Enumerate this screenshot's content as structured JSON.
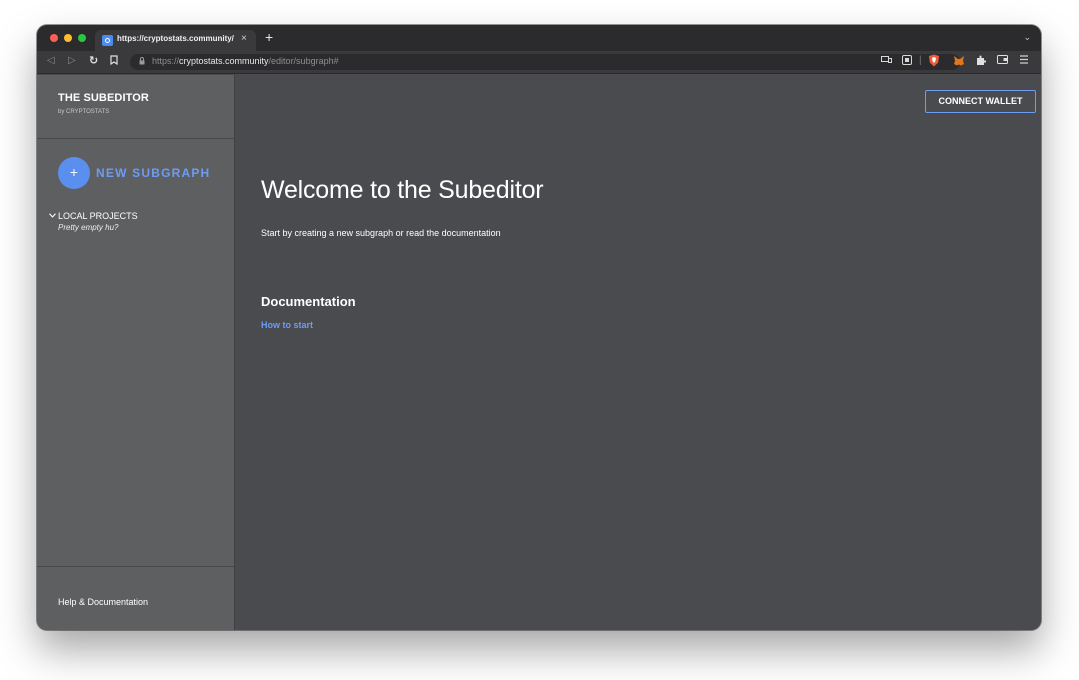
{
  "browser": {
    "tab_title": "https://cryptostats.community/",
    "tab_close": "×",
    "new_tab": "+",
    "tab_menu": "⌄",
    "url_scheme": "https://",
    "url_host": "cryptostats.community",
    "url_path": "/editor/subgraph#",
    "nav": {
      "back": "◁",
      "forward": "▷",
      "reload": "↻",
      "bookmark": "⊓"
    },
    "lock": "🔒︎"
  },
  "sidebar": {
    "title": "THE SUBEDITOR",
    "subtitle": "by CRYPTOSTATS",
    "new_button_icon": "+",
    "new_button_label": "NEW SUBGRAPH",
    "projects_chevron": "⌄",
    "projects_title": "LOCAL PROJECTS",
    "projects_empty": "Pretty empty hu?",
    "footer_link": "Help & Documentation"
  },
  "main": {
    "connect_button": "CONNECT WALLET",
    "heading": "Welcome to the Subeditor",
    "intro": "Start by creating a new subgraph or read the documentation",
    "doc_heading": "Documentation",
    "doc_link": "How to start"
  },
  "colors": {
    "accent": "#6d9cf5",
    "sidebar_bg": "#5e5f61",
    "main_bg": "#4a4b4e"
  }
}
